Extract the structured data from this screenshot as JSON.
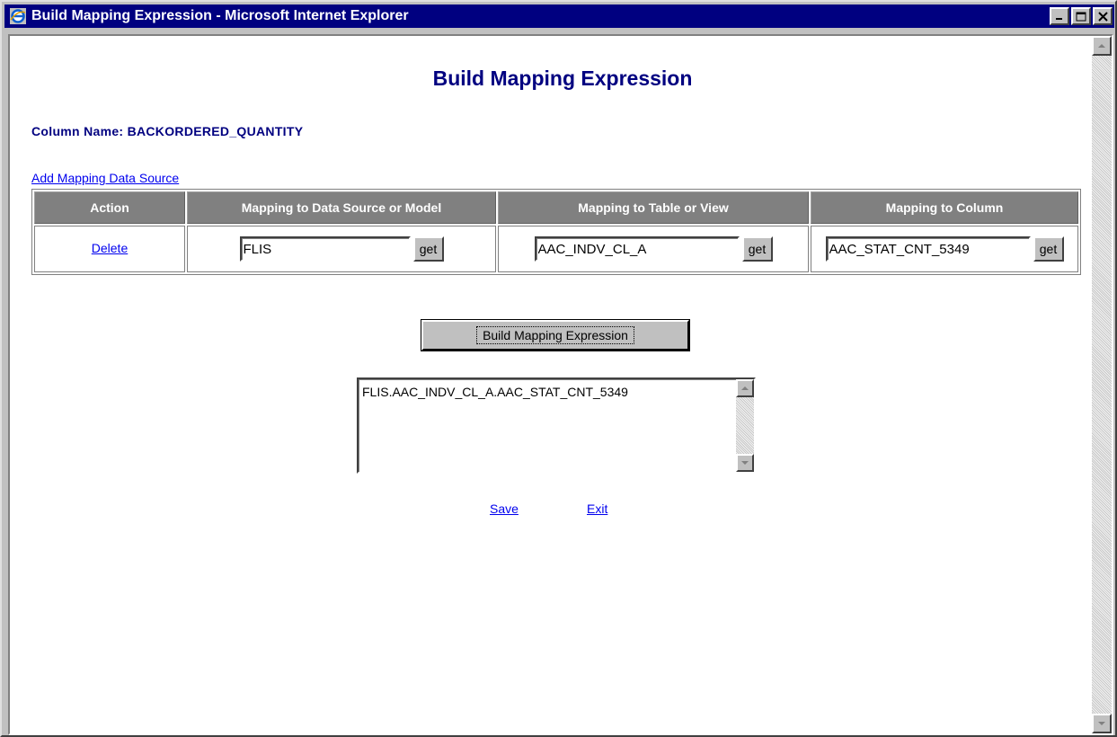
{
  "window": {
    "title": "Build Mapping Expression - Microsoft Internet Explorer",
    "icon": "internet-explorer-icon",
    "controls": [
      "minimize-icon",
      "maximize-icon",
      "close-icon"
    ]
  },
  "page": {
    "heading": "Build Mapping Expression",
    "column_name_label": "Column Name: BACKORDERED_QUANTITY",
    "add_link": "Add Mapping Data Source"
  },
  "table": {
    "headers": [
      "Action",
      "Mapping to Data Source or Model",
      "Mapping to Table or View",
      "Mapping to Column"
    ],
    "rows": [
      {
        "action": "Delete",
        "data_source": "FLIS",
        "table_view": "AAC_INDV_CL_A",
        "column": "AAC_STAT_CNT_5349",
        "get_label": "get"
      }
    ]
  },
  "build_button": "Build Mapping Expression",
  "expression": "FLIS.AAC_INDV_CL_A.AAC_STAT_CNT_5349",
  "footer": {
    "save": "Save",
    "exit": "Exit"
  },
  "colors": {
    "titlebar": "#000080",
    "heading": "#000080",
    "link": "#0000ee",
    "table_header": "#808080"
  }
}
